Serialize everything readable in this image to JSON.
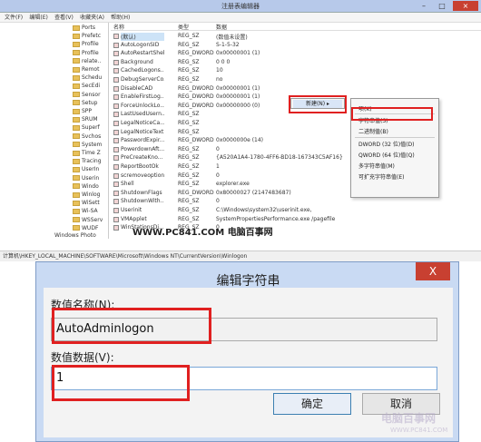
{
  "regedit": {
    "title": "注册表编辑器",
    "menu": [
      "文件(F)",
      "编辑(E)",
      "查看(V)",
      "收藏夹(A)",
      "帮助(H)"
    ],
    "tree_items": [
      "Ports",
      "Prefetc",
      "Profile",
      "Profile",
      "relate..",
      "Remot",
      "Schedu",
      "SecEdi",
      "Sensor",
      "Setup",
      "SPP",
      "SRUM",
      "Superf",
      "Svchos",
      "System",
      "Time Z",
      "Tracing",
      "UserIn",
      "Userin",
      "Windo",
      "Winlog",
      "WiSett",
      "Wi-SA",
      "WSServ",
      "WUDF"
    ],
    "tree_last": "Windows Photo",
    "columns": {
      "name": "名称",
      "type": "类型",
      "data": "数据"
    },
    "rows": [
      {
        "name": "(默认)",
        "type": "REG_SZ",
        "data": "(数值未设置)"
      },
      {
        "name": "AutoLogonSID",
        "type": "REG_SZ",
        "data": "S-1-5-32"
      },
      {
        "name": "AutoRestartShell",
        "type": "REG_DWORD",
        "data": "0x00000001 (1)"
      },
      {
        "name": "Background",
        "type": "REG_SZ",
        "data": "0 0 0"
      },
      {
        "name": "CachedLogons...",
        "type": "REG_SZ",
        "data": "10"
      },
      {
        "name": "DebugServerCo...",
        "type": "REG_SZ",
        "data": "no"
      },
      {
        "name": "DisableCAD",
        "type": "REG_DWORD",
        "data": "0x00000001 (1)"
      },
      {
        "name": "EnableFirstLog...",
        "type": "REG_DWORD",
        "data": "0x00000001 (1)"
      },
      {
        "name": "ForceUnlockLo...",
        "type": "REG_DWORD",
        "data": "0x00000000 (0)"
      },
      {
        "name": "LastUsedUsern...",
        "type": "REG_SZ",
        "data": ""
      },
      {
        "name": "LegalNoticeCa...",
        "type": "REG_SZ",
        "data": ""
      },
      {
        "name": "LegalNoticeText",
        "type": "REG_SZ",
        "data": ""
      },
      {
        "name": "PasswordExpir...",
        "type": "REG_DWORD",
        "data": "0x0000000e (14)"
      },
      {
        "name": "PowerdownAft...",
        "type": "REG_SZ",
        "data": "0"
      },
      {
        "name": "PreCreateKno...",
        "type": "REG_SZ",
        "data": "{A520A1A4-1780-4FF6-BD18-167343C5AF16}"
      },
      {
        "name": "ReportBootOk",
        "type": "REG_SZ",
        "data": "1"
      },
      {
        "name": "scremoveoption",
        "type": "REG_SZ",
        "data": "0"
      },
      {
        "name": "Shell",
        "type": "REG_SZ",
        "data": "explorer.exe"
      },
      {
        "name": "ShutdownFlags",
        "type": "REG_DWORD",
        "data": "0x80000027 (2147483687)"
      },
      {
        "name": "ShutdownWith...",
        "type": "REG_SZ",
        "data": "0"
      },
      {
        "name": "Userinit",
        "type": "REG_SZ",
        "data": "C:\\Windows\\system32\\userinit.exe,"
      },
      {
        "name": "VMApplet",
        "type": "REG_SZ",
        "data": "SystemPropertiesPerformance.exe /pagefile"
      },
      {
        "name": "WinStationsDi...",
        "type": "REG_SZ",
        "data": "0"
      }
    ],
    "status_path": "计算机\\HKEY_LOCAL_MACHINE\\SOFTWARE\\Microsoft\\Windows NT\\CurrentVersion\\Winlogon",
    "watermark": "WWW.PC841.COM 电脑百事网",
    "context_menu_new": "新建(N)",
    "submenu": [
      "项(K)",
      "字符串值(S)",
      "二进制值(B)",
      "DWORD (32 位)值(D)",
      "QWORD (64 位)值(Q)",
      "多字符串值(M)",
      "可扩充字符串值(E)"
    ]
  },
  "dialog": {
    "title": "编辑字符串",
    "close_glyph": "X",
    "name_label": "数值名称(N):",
    "name_value": "AutoAdminlogon",
    "data_label": "数值数据(V):",
    "data_value": "1",
    "ok_label": "确定",
    "cancel_label": "取消",
    "watermark": "电脑百事网",
    "watermark_sub": "WWW.PC841.COM"
  }
}
